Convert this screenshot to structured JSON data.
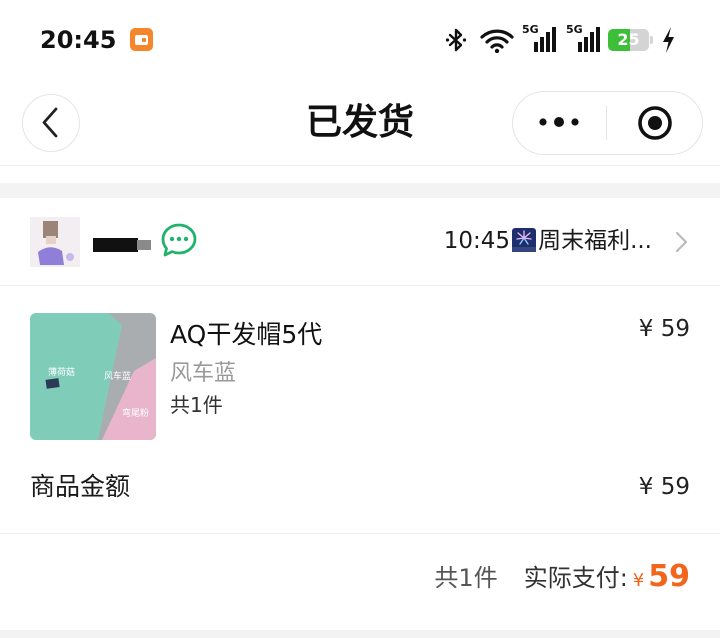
{
  "status_bar": {
    "time": "20:45",
    "app_icon": "wallet-app-icon",
    "network_1": "5G",
    "network_2": "5G",
    "battery_level": "25",
    "icons": [
      "bluetooth-icon",
      "wifi-icon",
      "signal-icon",
      "signal-icon",
      "battery-icon",
      "charging-bolt-icon"
    ]
  },
  "nav": {
    "title": "已发货",
    "back_icon": "back-chevron-icon",
    "more_icon": "more-dots-icon",
    "target_icon": "record-target-icon"
  },
  "shop": {
    "avatar": "shop-avatar",
    "chat_icon": "chat-bubble-icon",
    "notice_time": "10:45",
    "notice_emoji": "fireworks-icon",
    "notice_text": "周末福利...",
    "arrow_icon": "chevron-right-icon"
  },
  "product": {
    "title": "AQ干发帽5代",
    "price": "¥ 59",
    "variant": "风车蓝",
    "quantity": "共1件",
    "image_labels": [
      "薄荷菇",
      "风车蓝",
      "弯尾粉"
    ]
  },
  "summary": {
    "label": "商品金额",
    "value": "¥ 59"
  },
  "footer": {
    "count": "共1件",
    "paid_label": "实际支付:",
    "currency": "¥",
    "amount": "59"
  },
  "colors": {
    "accent": "#f2661c",
    "chat_green": "#21b36a",
    "battery_green": "#3dbf3a",
    "divider": "#eeeeee",
    "muted_text": "#9a9a9a"
  }
}
